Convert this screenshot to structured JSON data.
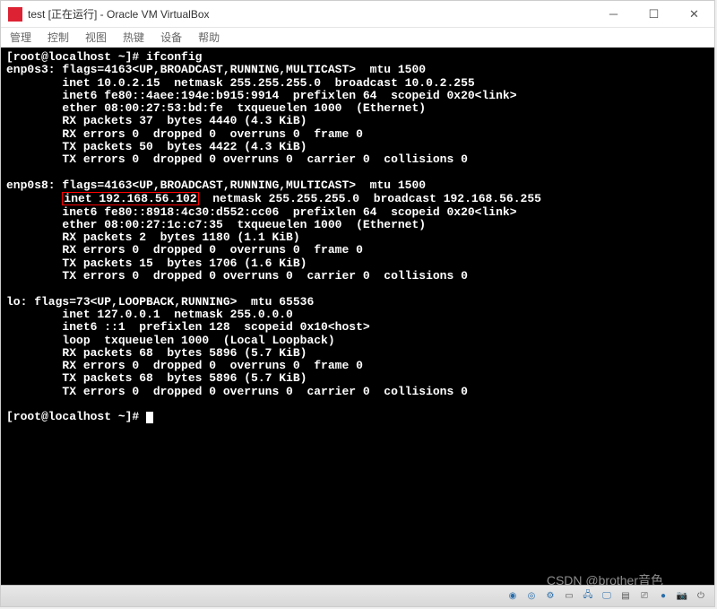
{
  "window": {
    "title": "test [正在运行] - Oracle VM VirtualBox"
  },
  "menu": {
    "manage": "管理",
    "control": "控制",
    "view": "视图",
    "hotkey": "热键",
    "device": "设备",
    "help": "帮助"
  },
  "terminal": {
    "prompt1": "[root@localhost ~]# ",
    "command1": "ifconfig",
    "interface1": {
      "name": "enp0s3:",
      "flags": " flags=4163<UP,BROADCAST,RUNNING,MULTICAST>  mtu 1500",
      "inet": "        inet 10.0.2.15  netmask 255.255.255.0  broadcast 10.0.2.255",
      "inet6": "        inet6 fe80::4aee:194e:b915:9914  prefixlen 64  scopeid 0x20<link>",
      "ether": "        ether 08:00:27:53:bd:fe  txqueuelen 1000  (Ethernet)",
      "rxp": "        RX packets 37  bytes 4440 (4.3 KiB)",
      "rxe": "        RX errors 0  dropped 0  overruns 0  frame 0",
      "txp": "        TX packets 50  bytes 4422 (4.3 KiB)",
      "txe": "        TX errors 0  dropped 0 overruns 0  carrier 0  collisions 0"
    },
    "interface2": {
      "name": "enp0s8:",
      "flags": " flags=4163<UP,BROADCAST,RUNNING,MULTICAST>  mtu 1500",
      "inet_pre": "        ",
      "inet_hl": "inet 192.168.56.102",
      "inet_post": "  netmask 255.255.255.0  broadcast 192.168.56.255",
      "inet6": "        inet6 fe80::8918:4c30:d552:cc06  prefixlen 64  scopeid 0x20<link>",
      "ether": "        ether 08:00:27:1c:c7:35  txqueuelen 1000  (Ethernet)",
      "rxp": "        RX packets 2  bytes 1180 (1.1 KiB)",
      "rxe": "        RX errors 0  dropped 0  overruns 0  frame 0",
      "txp": "        TX packets 15  bytes 1706 (1.6 KiB)",
      "txe": "        TX errors 0  dropped 0 overruns 0  carrier 0  collisions 0"
    },
    "interface3": {
      "name": "lo:",
      "flags": " flags=73<UP,LOOPBACK,RUNNING>  mtu 65536",
      "inet": "        inet 127.0.0.1  netmask 255.0.0.0",
      "inet6": "        inet6 ::1  prefixlen 128  scopeid 0x10<host>",
      "loop": "        loop  txqueuelen 1000  (Local Loopback)",
      "rxp": "        RX packets 68  bytes 5896 (5.7 KiB)",
      "rxe": "        RX errors 0  dropped 0  overruns 0  frame 0",
      "txp": "        TX packets 68  bytes 5896 (5.7 KiB)",
      "txe": "        TX errors 0  dropped 0 overruns 0  carrier 0  collisions 0"
    },
    "prompt2": "[root@localhost ~]# "
  },
  "watermark": "CSDN @brother音色"
}
